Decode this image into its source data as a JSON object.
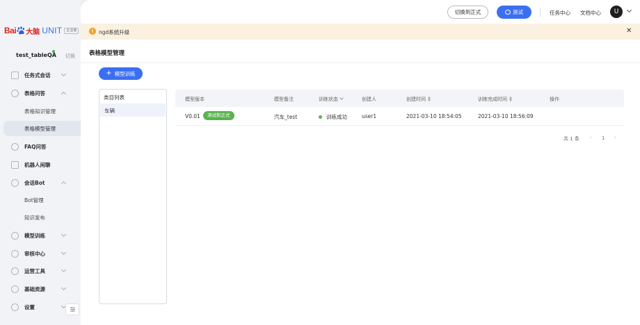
{
  "brand": {
    "logo_bai": "Bai",
    "logo_du": "大脑",
    "product": "UNIT",
    "edition": "企业版"
  },
  "bot": {
    "name": "test_tableQA",
    "switch_label": "切换"
  },
  "sidebar": {
    "items": [
      {
        "label": "任务式会话",
        "icon": "task-icon"
      },
      {
        "label": "表格问答",
        "icon": "table-icon"
      },
      {
        "label": "表格知识管理"
      },
      {
        "label": "表格模型管理"
      },
      {
        "label": "FAQ问答",
        "icon": "faq-icon"
      },
      {
        "label": "机器人闲聊",
        "icon": "chat-icon"
      },
      {
        "label": "会话Bot",
        "icon": "bot-icon"
      },
      {
        "label": "Bot管理"
      },
      {
        "label": "知识发布"
      },
      {
        "label": "模型训练",
        "icon": "train-icon"
      },
      {
        "label": "审核中心",
        "icon": "audit-icon"
      },
      {
        "label": "运营工具",
        "icon": "ops-icon"
      },
      {
        "label": "基础资源",
        "icon": "resource-icon"
      },
      {
        "label": "设置",
        "icon": "settings-icon"
      }
    ]
  },
  "topbar": {
    "switch_official": "切换到正式",
    "test_button": "测试",
    "task_center": "任务中心",
    "doc_center": "文档中心",
    "avatar_initial": "U"
  },
  "notice": {
    "text": "ngd系统升级",
    "close": "✕"
  },
  "page": {
    "title": "表格模型管理",
    "train_button": "模型训练",
    "train_plus": "+"
  },
  "category": {
    "header": "类目列表",
    "items": [
      "车辆"
    ]
  },
  "table": {
    "columns": [
      "模型版本",
      "模型备注",
      "训练状态",
      "创建人",
      "创建时间",
      "训练完成时间",
      "操作"
    ],
    "rows": [
      {
        "version": "V0.01",
        "tag": "测试和正式",
        "note": "汽车_test",
        "status": "训练成功",
        "creator": "user1",
        "created": "2021-03-10 18:54:05",
        "finished": "2021-03-10 18:56:09"
      }
    ]
  },
  "pagination": {
    "total": "共 1 条",
    "prev": "‹",
    "page": "1",
    "next": "›"
  },
  "colors": {
    "primary": "#3b6ff2",
    "success": "#5ab34e",
    "notice_bg": "#fbf1e0",
    "brand_red": "#e0241f"
  }
}
